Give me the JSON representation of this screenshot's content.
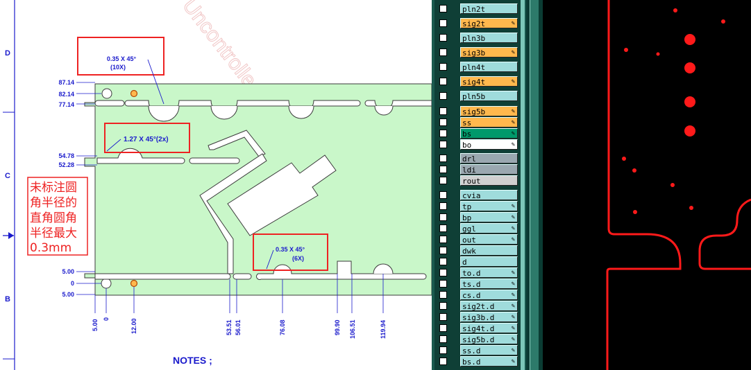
{
  "drawing": {
    "row_letters": [
      "D",
      "C",
      "B"
    ],
    "notes_label": "NOTES ;",
    "watermark": "Uncontrolled copy   W",
    "callouts": [
      {
        "line1": "0.35 X 45°",
        "line2": "(10X)"
      },
      {
        "line1": "1.27 X 45°(2x)",
        "line2": ""
      },
      {
        "line1": "0.35 X 45°",
        "line2": "(6X)"
      }
    ],
    "chinese_note": [
      "未标注圆",
      "角半径的",
      "直角圆角",
      "半径最大",
      "0.3mm"
    ],
    "left_dims": [
      "87.14",
      "82.14",
      "77.14",
      "54.78",
      "52.28",
      "5.00",
      "0",
      "5.00"
    ],
    "bottom_dims": [
      "5.00",
      "0",
      "12.00",
      "53.51",
      "56.01",
      "76.08",
      "99.90",
      "106.51",
      "119.94"
    ]
  },
  "colors": {
    "board_fill": "#c9f7c9",
    "dim_blue": "#1a1acc",
    "callout_red": "#ee2222",
    "layer_cyan": "#9fdcdc",
    "layer_orange": "#ffb84d",
    "layer_green": "#00996b",
    "layer_gray": "#9aa8b0",
    "panel_teal": "#1a5a4e",
    "cam_red": "#ff1a1a"
  },
  "layers": [
    {
      "name": "pln2t",
      "color": "#9fdcdc",
      "edit": false
    },
    {
      "name": "sig2t",
      "color": "#ffb84d",
      "edit": true
    },
    {
      "name": "pln3b",
      "color": "#9fdcdc",
      "edit": false
    },
    {
      "name": "sig3b",
      "color": "#ffb84d",
      "edit": true
    },
    {
      "name": "pln4t",
      "color": "#9fdcdc",
      "edit": false
    },
    {
      "name": "sig4t",
      "color": "#ffb84d",
      "edit": true
    },
    {
      "name": "pln5b",
      "color": "#9fdcdc",
      "edit": false
    },
    {
      "name": "sig5b",
      "color": "#ffb84d",
      "edit": true
    },
    {
      "name": "ss",
      "color": "#ffb84d",
      "edit": true
    },
    {
      "name": "bs",
      "color": "#00996b",
      "edit": true
    },
    {
      "name": "bo",
      "color": "#ffffff",
      "edit": true
    },
    {
      "name": "drl",
      "color": "#9aa8b0",
      "edit": false
    },
    {
      "name": "ldi",
      "color": "#9aa8b0",
      "edit": false
    },
    {
      "name": "rout",
      "color": "#d0d0d0",
      "edit": false
    },
    {
      "name": "cvia",
      "color": "#9fdcdc",
      "edit": false
    },
    {
      "name": "tp",
      "color": "#9fdcdc",
      "edit": true
    },
    {
      "name": "bp",
      "color": "#9fdcdc",
      "edit": true
    },
    {
      "name": "ggl",
      "color": "#9fdcdc",
      "edit": true
    },
    {
      "name": "out",
      "color": "#9fdcdc",
      "edit": true
    },
    {
      "name": "dwk",
      "color": "#9fdcdc",
      "edit": false
    },
    {
      "name": "d",
      "color": "#9fdcdc",
      "edit": false
    },
    {
      "name": "to.d",
      "color": "#9fdcdc",
      "edit": true
    },
    {
      "name": "ts.d",
      "color": "#9fdcdc",
      "edit": true
    },
    {
      "name": "cs.d",
      "color": "#9fdcdc",
      "edit": true
    },
    {
      "name": "sig2t.d",
      "color": "#9fdcdc",
      "edit": true
    },
    {
      "name": "sig3b.d",
      "color": "#9fdcdc",
      "edit": true
    },
    {
      "name": "sig4t.d",
      "color": "#9fdcdc",
      "edit": true
    },
    {
      "name": "sig5b.d",
      "color": "#9fdcdc",
      "edit": true
    },
    {
      "name": "ss.d",
      "color": "#9fdcdc",
      "edit": true
    },
    {
      "name": "bs.d",
      "color": "#9fdcdc",
      "edit": true
    }
  ],
  "icons": {
    "edit": "pencil-icon",
    "toggle": "checkbox-icon",
    "marker": "arrow-right-icon"
  }
}
